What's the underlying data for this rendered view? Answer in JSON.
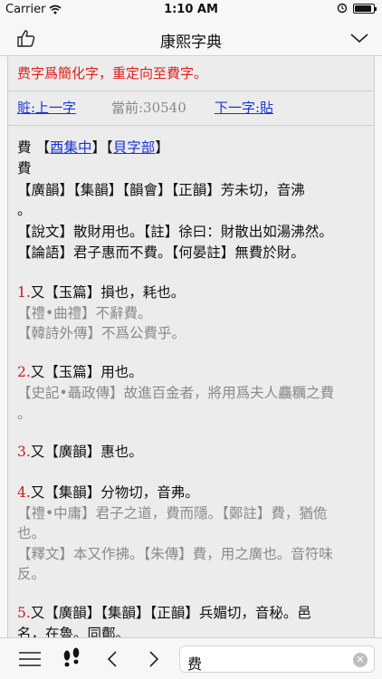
{
  "status": {
    "carrier": "Carrier",
    "time": "1:10 AM",
    "battery_level": 0.92
  },
  "nav": {
    "title": "康熙字典"
  },
  "notice": "费字爲簡化字，重定向至費字。",
  "navrow": {
    "prev": "賍:上一字",
    "current": "當前:30540",
    "next": "下一字:貼"
  },
  "entry": {
    "head_char": "費",
    "set_link": "酉集中",
    "radical_link": "貝字部",
    "char2": "費",
    "line1": "【廣韻】【集韻】【韻會】【正韻】",
    "line1b": "芳未切，音沸",
    "line1_wrap": "。",
    "line2": "【說文】散財用也。【註】徐曰：財散出如湯沸然。",
    "line3": "【論語】君子惠而不費。【何晏註】無費於財。",
    "s1_num": "1.",
    "s1_text": "又【玉篇】損也，耗也。",
    "s1_g1": "【禮•曲禮】不辭費。",
    "s1_g2": "【韓詩外傳】不爲公費乎。",
    "s2_num": "2.",
    "s2_text": "又【玉篇】用也。",
    "s2_g1": "【史記•聶政傳】故進百金者，將用爲夫人麤糲之費",
    "s2_g1_wrap": "。",
    "s3_num": "3.",
    "s3_text": "又【廣韻】惠也。",
    "s4_num": "4.",
    "s4_text": "又【集韻】分物切，音弗。",
    "s4_g1": "【禮•中庸】君子之道，費而隱。【鄭註】費，猶佹",
    "s4_g1_wrap": "也。",
    "s4_g2": "【釋文】本又作拂。【朱傳】費，用之廣也。音符味",
    "s4_g2_wrap": "反。",
    "s5_num": "5.",
    "s5_text": "又【廣韻】【集韻】【正韻】",
    "s5_textb": "兵媚切，音秘。邑",
    "s5_wrap": "名，在魯。同鄪。"
  },
  "search": {
    "value": "费"
  },
  "icons": {
    "like": "thumbs-up-icon",
    "menu": "chevron-down-icon",
    "list": "hamburger-icon",
    "history": "footprints-icon",
    "back": "chevron-left-icon",
    "forward": "chevron-right-icon",
    "clear": "clear-icon"
  }
}
